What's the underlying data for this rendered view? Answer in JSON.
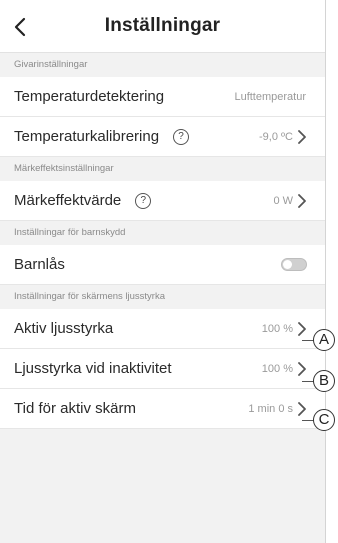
{
  "header": {
    "title": "Inställningar",
    "back_icon": "chevron-left-icon"
  },
  "sections": {
    "sensor": {
      "title": "Givarinställningar",
      "temp_detection": {
        "label": "Temperaturdetektering",
        "value": "Lufttemperatur"
      },
      "temp_calibration": {
        "label": "Temperaturkalibrering",
        "help": "?",
        "value": "-9,0 ºC"
      }
    },
    "rated_power": {
      "title": "Märkeffektsinställningar",
      "rated_power_value": {
        "label": "Märkeffektvärde",
        "help": "?",
        "value": "0 W"
      }
    },
    "child_lock": {
      "title": "Inställningar för barnskydd",
      "lock": {
        "label": "Barnlås",
        "enabled": false
      }
    },
    "brightness": {
      "title": "Inställningar för skärmens ljusstyrka",
      "active": {
        "label": "Aktiv ljusstyrka",
        "value": "100 %",
        "callout": "A"
      },
      "idle": {
        "label": "Ljusstyrka vid inaktivitet",
        "value": "100 %",
        "callout": "B"
      },
      "active_time": {
        "label": "Tid för aktiv skärm",
        "value": "1 min 0 s",
        "callout": "C"
      }
    }
  },
  "colors": {
    "background": "#f2f2f2",
    "row": "#ffffff",
    "value_text": "#9a9a9a"
  }
}
